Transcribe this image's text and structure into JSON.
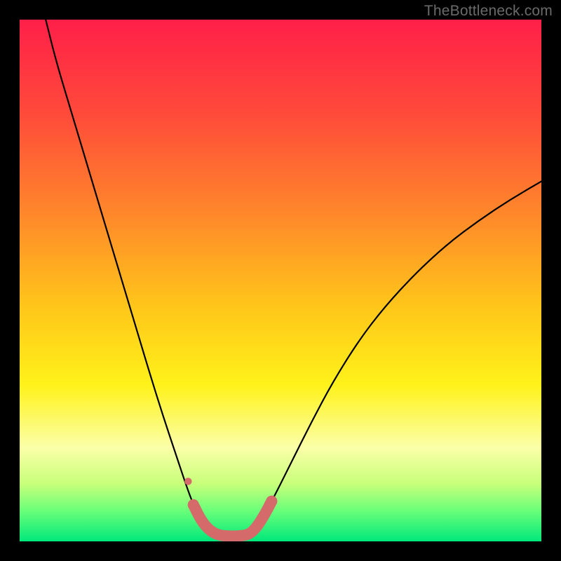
{
  "watermark": "TheBottleneck.com",
  "chart_data": {
    "type": "line",
    "title": "",
    "xlabel": "",
    "ylabel": "",
    "xlim": [
      0,
      100
    ],
    "ylim": [
      0,
      100
    ],
    "grid": false,
    "axes_visible": false,
    "background_gradient": {
      "stops": [
        {
          "offset": 0.0,
          "color": "#ff1f49"
        },
        {
          "offset": 0.18,
          "color": "#ff4a3a"
        },
        {
          "offset": 0.38,
          "color": "#ff8a2a"
        },
        {
          "offset": 0.55,
          "color": "#ffc61a"
        },
        {
          "offset": 0.7,
          "color": "#fff21a"
        },
        {
          "offset": 0.82,
          "color": "#fbffa8"
        },
        {
          "offset": 0.89,
          "color": "#c8ff7a"
        },
        {
          "offset": 0.94,
          "color": "#6cff7a"
        },
        {
          "offset": 1.0,
          "color": "#00e87a"
        }
      ]
    },
    "series": [
      {
        "name": "bottleneck-curve-left",
        "stroke": "#000000",
        "stroke_width": 2.2,
        "points": [
          {
            "x": 5.0,
            "y": 100.0
          },
          {
            "x": 7.0,
            "y": 92.0
          },
          {
            "x": 10.0,
            "y": 82.0
          },
          {
            "x": 13.0,
            "y": 72.0
          },
          {
            "x": 16.0,
            "y": 62.0
          },
          {
            "x": 19.0,
            "y": 52.0
          },
          {
            "x": 22.0,
            "y": 42.0
          },
          {
            "x": 25.0,
            "y": 32.0
          },
          {
            "x": 27.5,
            "y": 24.0
          },
          {
            "x": 30.0,
            "y": 16.5
          },
          {
            "x": 32.0,
            "y": 10.5
          },
          {
            "x": 33.5,
            "y": 6.5
          },
          {
            "x": 35.0,
            "y": 3.8
          },
          {
            "x": 36.5,
            "y": 2.0
          },
          {
            "x": 38.0,
            "y": 1.2
          }
        ]
      },
      {
        "name": "bottleneck-curve-right",
        "stroke": "#000000",
        "stroke_width": 2.2,
        "points": [
          {
            "x": 44.0,
            "y": 1.2
          },
          {
            "x": 46.0,
            "y": 3.5
          },
          {
            "x": 48.5,
            "y": 8.0
          },
          {
            "x": 52.0,
            "y": 15.0
          },
          {
            "x": 56.0,
            "y": 23.0
          },
          {
            "x": 60.0,
            "y": 30.5
          },
          {
            "x": 65.0,
            "y": 38.5
          },
          {
            "x": 70.0,
            "y": 45.0
          },
          {
            "x": 76.0,
            "y": 51.5
          },
          {
            "x": 82.0,
            "y": 57.0
          },
          {
            "x": 88.0,
            "y": 61.5
          },
          {
            "x": 94.0,
            "y": 65.5
          },
          {
            "x": 100.0,
            "y": 69.0
          }
        ]
      }
    ],
    "highlight": {
      "name": "optimal-range",
      "stroke": "#d46a6a",
      "stroke_width": 16,
      "dot_radius": 8,
      "points": [
        {
          "x": 33.3,
          "y": 7.0
        },
        {
          "x": 34.8,
          "y": 4.0
        },
        {
          "x": 36.3,
          "y": 2.2
        },
        {
          "x": 38.0,
          "y": 1.2
        },
        {
          "x": 40.0,
          "y": 1.0
        },
        {
          "x": 42.0,
          "y": 1.0
        },
        {
          "x": 44.0,
          "y": 1.3
        },
        {
          "x": 45.5,
          "y": 2.8
        },
        {
          "x": 47.0,
          "y": 5.2
        },
        {
          "x": 48.3,
          "y": 7.7
        }
      ],
      "extra_dot": {
        "x": 32.3,
        "y": 11.5
      }
    }
  }
}
